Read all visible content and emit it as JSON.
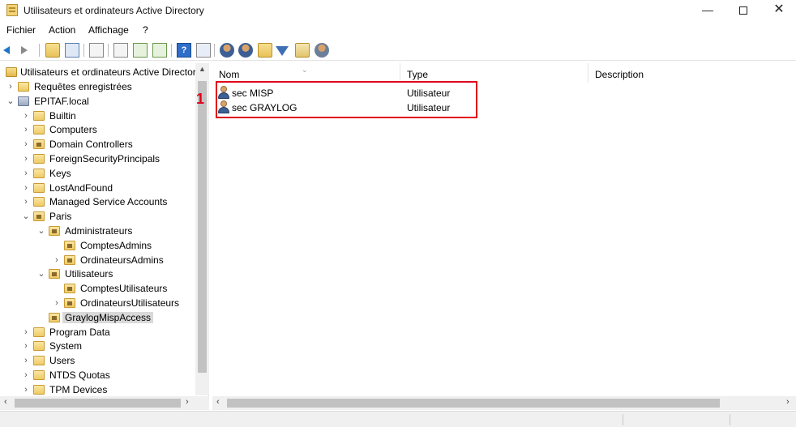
{
  "window": {
    "title": "Utilisateurs et ordinateurs Active Directory",
    "min_glyph": "—",
    "close_glyph": "✕"
  },
  "menu": [
    "Fichier",
    "Action",
    "Affichage",
    "?"
  ],
  "toolbar": {
    "icons": [
      "back-icon",
      "forward-icon",
      "up-folder-icon",
      "show-tree-icon",
      "properties-icon",
      "export-icon",
      "refresh-icon",
      "export-list-icon",
      "help-icon",
      "console-tree-icon",
      "new-user-icon",
      "new-group-icon",
      "new-ou-icon",
      "filter-icon",
      "add-to-group-icon",
      "delegate-icon"
    ]
  },
  "tree": {
    "root": "Utilisateurs et ordinateurs Active Directory",
    "items": [
      {
        "label": "Requêtes enregistrées",
        "depth": 0,
        "expander": "›",
        "icon": "folder"
      },
      {
        "label": "EPITAF.local",
        "depth": 0,
        "expander": "⌄",
        "icon": "domain"
      },
      {
        "label": "Builtin",
        "depth": 1,
        "expander": "›",
        "icon": "folder"
      },
      {
        "label": "Computers",
        "depth": 1,
        "expander": "›",
        "icon": "folder"
      },
      {
        "label": "Domain Controllers",
        "depth": 1,
        "expander": "›",
        "icon": "ou"
      },
      {
        "label": "ForeignSecurityPrincipals",
        "depth": 1,
        "expander": "›",
        "icon": "folder"
      },
      {
        "label": "Keys",
        "depth": 1,
        "expander": "›",
        "icon": "folder"
      },
      {
        "label": "LostAndFound",
        "depth": 1,
        "expander": "›",
        "icon": "folder"
      },
      {
        "label": "Managed Service Accounts",
        "depth": 1,
        "expander": "›",
        "icon": "folder"
      },
      {
        "label": "Paris",
        "depth": 1,
        "expander": "⌄",
        "icon": "ou"
      },
      {
        "label": "Administrateurs",
        "depth": 2,
        "expander": "⌄",
        "icon": "ou"
      },
      {
        "label": "ComptesAdmins",
        "depth": 3,
        "expander": "",
        "icon": "ou"
      },
      {
        "label": "OrdinateursAdmins",
        "depth": 3,
        "expander": "›",
        "icon": "ou"
      },
      {
        "label": "Utilisateurs",
        "depth": 2,
        "expander": "⌄",
        "icon": "ou"
      },
      {
        "label": "ComptesUtilisateurs",
        "depth": 3,
        "expander": "",
        "icon": "ou"
      },
      {
        "label": "OrdinateursUtilisateurs",
        "depth": 3,
        "expander": "›",
        "icon": "ou"
      },
      {
        "label": "GraylogMispAccess",
        "depth": 2,
        "expander": "",
        "icon": "ou",
        "selected": true
      },
      {
        "label": "Program Data",
        "depth": 1,
        "expander": "›",
        "icon": "folder"
      },
      {
        "label": "System",
        "depth": 1,
        "expander": "›",
        "icon": "folder"
      },
      {
        "label": "Users",
        "depth": 1,
        "expander": "›",
        "icon": "folder"
      },
      {
        "label": "NTDS Quotas",
        "depth": 1,
        "expander": "›",
        "icon": "folder"
      },
      {
        "label": "TPM Devices",
        "depth": 1,
        "expander": "›",
        "icon": "folder"
      }
    ]
  },
  "list": {
    "columns": [
      "Nom",
      "Type",
      "Description"
    ],
    "rows": [
      {
        "name": "sec MISP",
        "type": "Utilisateur",
        "description": ""
      },
      {
        "name": "sec GRAYLOG",
        "type": "Utilisateur",
        "description": ""
      }
    ]
  },
  "annotation": {
    "label": "1",
    "color": "#e0001a"
  },
  "scroll_glyphs": {
    "left": "‹",
    "right": "›",
    "up": "▲"
  }
}
